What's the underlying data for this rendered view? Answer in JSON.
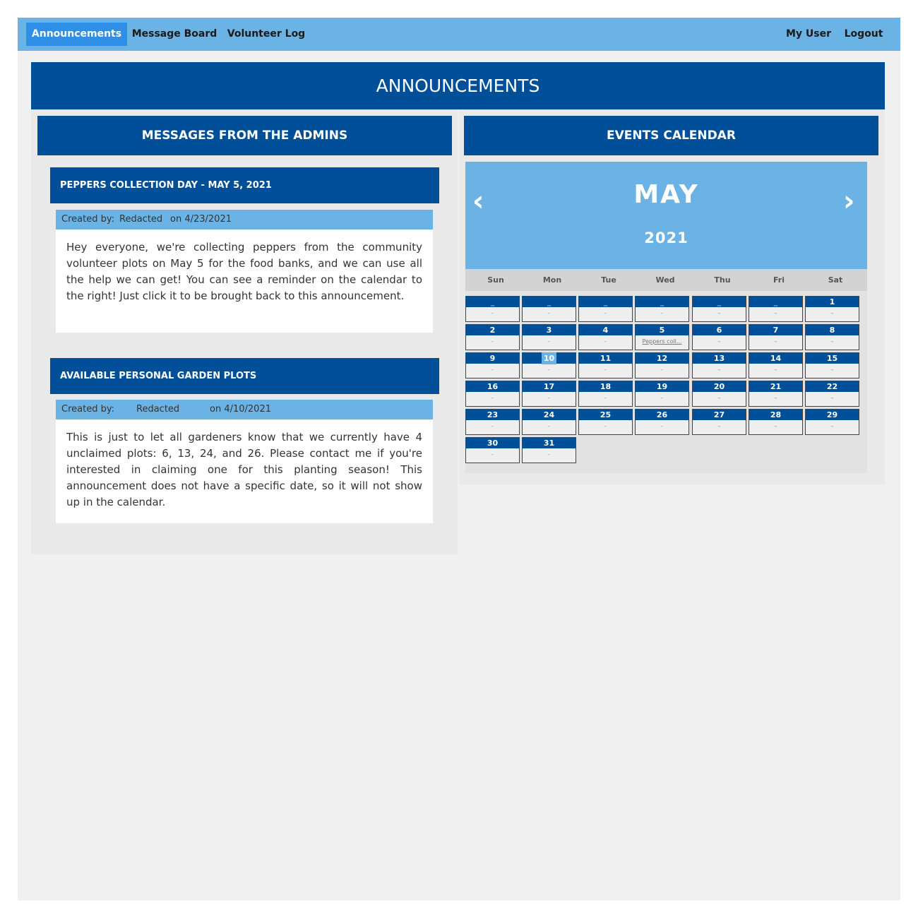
{
  "nav": {
    "left": [
      "Announcements",
      "Message Board",
      "Volunteer Log"
    ],
    "right": [
      "My User",
      "Logout"
    ],
    "active": "Announcements"
  },
  "page_title": "ANNOUNCEMENTS",
  "messages": {
    "header": "MESSAGES FROM THE ADMINS",
    "items": [
      {
        "title": "PEPPERS COLLECTION DAY - MAY 5, 2021",
        "created_label": "Created by:",
        "author": "Redacted",
        "date": "on 4/23/2021",
        "body": "Hey everyone, we're collecting peppers from the community volunteer plots on May 5 for the food banks, and we can use all the help we can get! You can see a reminder on the calendar to the right! Just click it to be brought back to this announcement."
      },
      {
        "title": "AVAILABLE PERSONAL GARDEN PLOTS",
        "created_label": "Created by:",
        "author": "Redacted",
        "date": "on 4/10/2021",
        "body": "This is just to let all gardeners know that we currently have 4 unclaimed plots: 6, 13, 24, and 26. Please contact me if you're interested in claiming one for this planting season! This announcement does not have a specific date, so it will not show up in the calendar."
      }
    ]
  },
  "calendar": {
    "header": "EVENTS CALENDAR",
    "month": "MAY",
    "year": "2021",
    "prev_icon": "chevron-left-icon",
    "next_icon": "chevron-right-icon",
    "prev_glyph": "‹",
    "next_glyph": "›",
    "weekdays": [
      "Sun",
      "Mon",
      "Tue",
      "Wed",
      "Thu",
      "Fri",
      "Sat"
    ],
    "placeholder": "_",
    "empty_event": "–",
    "leading_blanks": 6,
    "days": [
      "1",
      "2",
      "3",
      "4",
      "5",
      "6",
      "7",
      "8",
      "9",
      "10",
      "11",
      "12",
      "13",
      "14",
      "15",
      "16",
      "17",
      "18",
      "19",
      "20",
      "21",
      "22",
      "23",
      "24",
      "25",
      "26",
      "27",
      "28",
      "29",
      "30",
      "31"
    ],
    "today": "10",
    "events": {
      "5": "Peppers coll..."
    }
  },
  "colors": {
    "nav_bg": "#6bb2e5",
    "nav_active": "#2f8fe6",
    "primary": "#004f98",
    "accent": "#6bb2e5",
    "page_bg": "#f0f0f0"
  }
}
